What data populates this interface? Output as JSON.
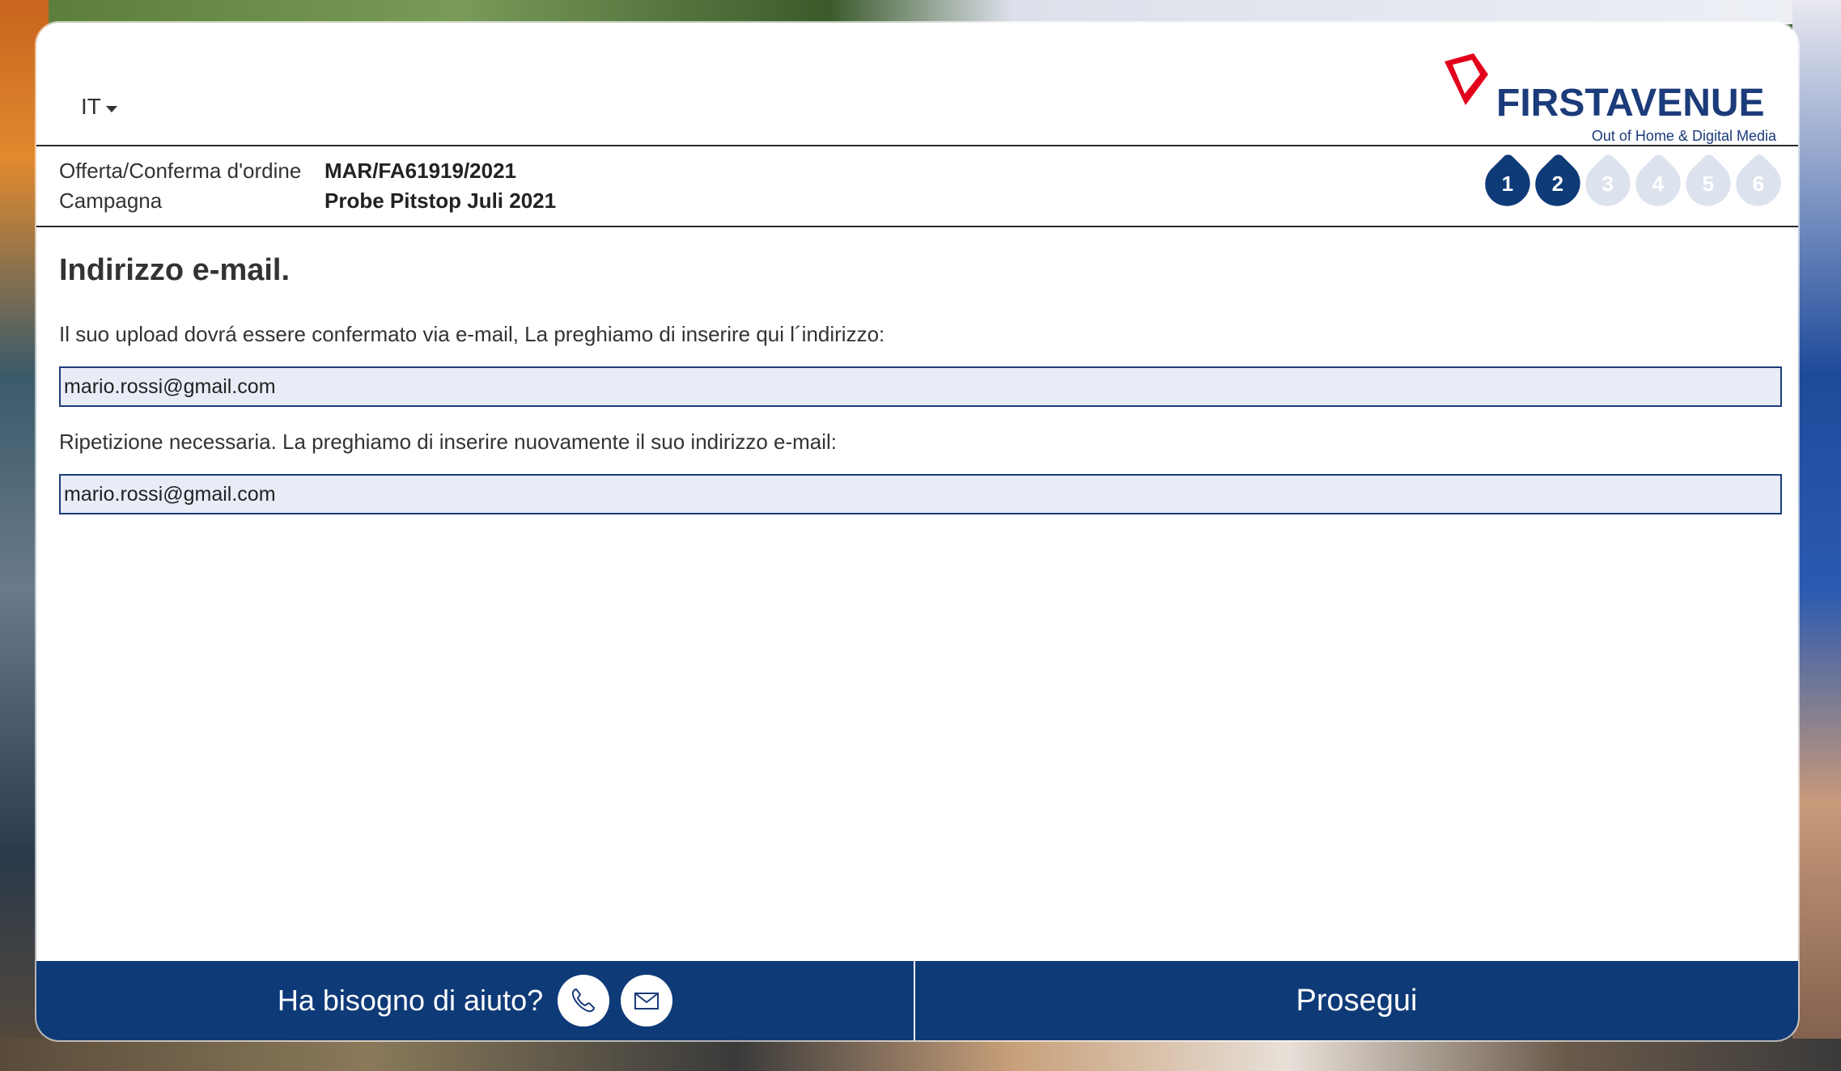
{
  "header": {
    "language": "IT",
    "logo": {
      "word": "FIRSTAVENUE",
      "subtitle": "Out of Home & Digital Media",
      "brand_color": "#1b3b7a",
      "mark_color": "#e3001b"
    }
  },
  "order_info": {
    "labels": [
      "Offerta/Conferma d'ordine",
      "Campagna"
    ],
    "values": [
      "MAR/FA61919/2021",
      "Probe Pitstop Juli 2021"
    ]
  },
  "steps": [
    {
      "label": "1",
      "state": "active"
    },
    {
      "label": "2",
      "state": "active"
    },
    {
      "label": "3",
      "state": "inactive"
    },
    {
      "label": "4",
      "state": "inactive"
    },
    {
      "label": "5",
      "state": "inactive"
    },
    {
      "label": "6",
      "state": "inactive"
    }
  ],
  "main": {
    "title": "Indirizzo e-mail.",
    "instruction": "Il suo upload dovrá essere confermato via e-mail, La preghiamo di inserire qui l´indirizzo:",
    "email_value": "mario.rossi@gmail.com",
    "repeat_instruction": "Ripetizione necessaria. La preghiamo di inserire nuovamente il suo indirizzo e-mail:",
    "email_repeat_value": "mario.rossi@gmail.com"
  },
  "footer": {
    "help_text": "Ha bisogno di aiuto?",
    "phone_icon": "phone-icon",
    "mail_icon": "mail-icon",
    "next_label": "Prosegui",
    "bar_color": "#0f3a78"
  }
}
